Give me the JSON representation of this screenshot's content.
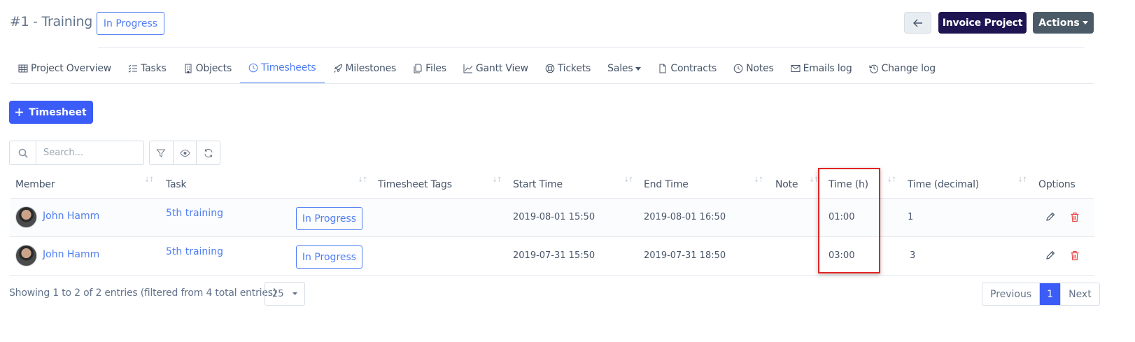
{
  "header": {
    "title": "#1 - Training",
    "status": "In Progress",
    "invoice_label": "Invoice Project",
    "actions_label": "Actions"
  },
  "tabs": [
    {
      "label": "Project Overview",
      "icon": "grid-icon"
    },
    {
      "label": "Tasks",
      "icon": "checklist-icon"
    },
    {
      "label": "Objects",
      "icon": "building-icon"
    },
    {
      "label": "Timesheets",
      "icon": "clock-icon",
      "active": true
    },
    {
      "label": "Milestones",
      "icon": "rocket-icon"
    },
    {
      "label": "Files",
      "icon": "files-icon"
    },
    {
      "label": "Gantt View",
      "icon": "chart-line-icon"
    },
    {
      "label": "Tickets",
      "icon": "lifebuoy-icon"
    },
    {
      "label": "Sales",
      "icon": "caret-down-icon"
    },
    {
      "label": "Contracts",
      "icon": "document-icon"
    },
    {
      "label": "Notes",
      "icon": "clock-icon"
    },
    {
      "label": "Emails log",
      "icon": "envelope-icon"
    },
    {
      "label": "Change log",
      "icon": "history-icon"
    }
  ],
  "add_button_label": "Timesheet",
  "search": {
    "placeholder": "Search..."
  },
  "table": {
    "headers": {
      "member": "Member",
      "task": "Task",
      "tags": "Timesheet Tags",
      "start": "Start Time",
      "end": "End Time",
      "note": "Note",
      "time_h": "Time (h)",
      "time_decimal": "Time (decimal)",
      "options": "Options"
    },
    "rows": [
      {
        "member": "John Hamm",
        "task": "5th training",
        "status": "In Progress",
        "start": "2019-08-01 15:50",
        "end": "2019-08-01 16:50",
        "time_h": "01:00",
        "time_decimal": "1"
      },
      {
        "member": "John Hamm",
        "task": "5th training",
        "status": "In Progress",
        "start": "2019-07-31 15:50",
        "end": "2019-07-31 18:50",
        "time_h": "03:00",
        "time_decimal": "3"
      }
    ]
  },
  "footer": {
    "showing": "Showing 1 to 2 of 2 entries (filtered from 4 total entries)",
    "page_size": "25",
    "previous": "Previous",
    "current_page": "1",
    "next": "Next"
  },
  "colors": {
    "accent": "#4f7ef3",
    "primary_button": "#3b5cf6",
    "invoice_button": "#1e1452",
    "actions_button": "#4b5a67",
    "highlight": "#e02424"
  }
}
